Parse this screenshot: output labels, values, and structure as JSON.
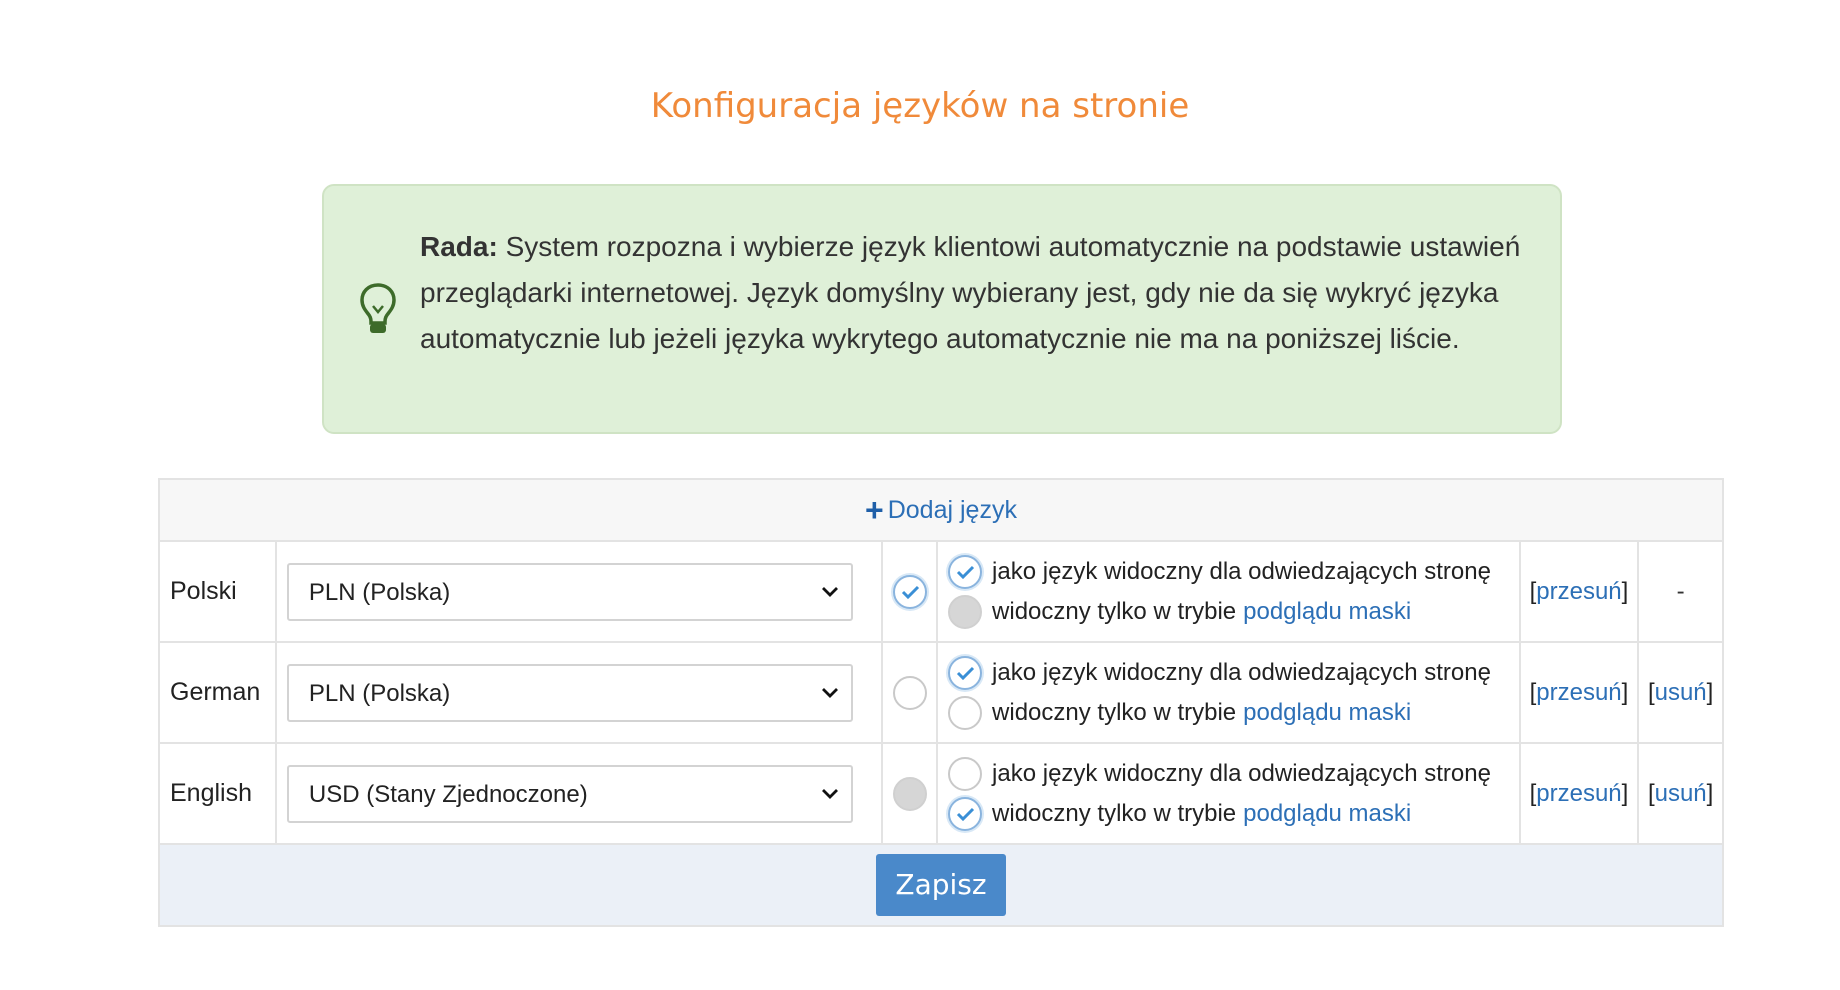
{
  "page": {
    "title": "Konfiguracja języków na stronie"
  },
  "tip": {
    "label": "Rada:",
    "text": " System rozpozna i wybierze język klientowi automatycznie na podstawie ustawień przeglądarki internetowej. Język domyślny wybierany jest, gdy nie da się wykryć języka automatycznie lub jeżeli języka wykrytego automatycznie nie ma na poniższej liście.",
    "icon": "lightbulb-icon",
    "colors": {
      "background": "#dff0d8",
      "icon": "#3d6b2a"
    }
  },
  "table": {
    "add_language_label": "Dodaj język",
    "visible_label": "jako język widoczny dla odwiedzających stronę",
    "mask_only_prefix": "widoczny tylko w trybie",
    "mask_preview_link": "podglądu maski",
    "move_label": "przesuń",
    "delete_label": "usuń",
    "no_delete": "-",
    "rows": [
      {
        "name": "Polski",
        "currency": "PLN (Polska)",
        "default": "checked",
        "visible": true,
        "mask_only": false,
        "deletable": false
      },
      {
        "name": "German",
        "currency": "PLN (Polska)",
        "default": "unchecked",
        "visible": true,
        "mask_only": false,
        "deletable": true
      },
      {
        "name": "English",
        "currency": "USD (Stany Zjednoczone)",
        "default": "disabled",
        "visible": false,
        "mask_only": true,
        "deletable": true
      }
    ]
  },
  "save_label": "Zapisz",
  "colors": {
    "title": "#f08a3a",
    "link": "#2c6fb6",
    "button": "#4a89ca",
    "footer_background": "#ebf0f7"
  }
}
